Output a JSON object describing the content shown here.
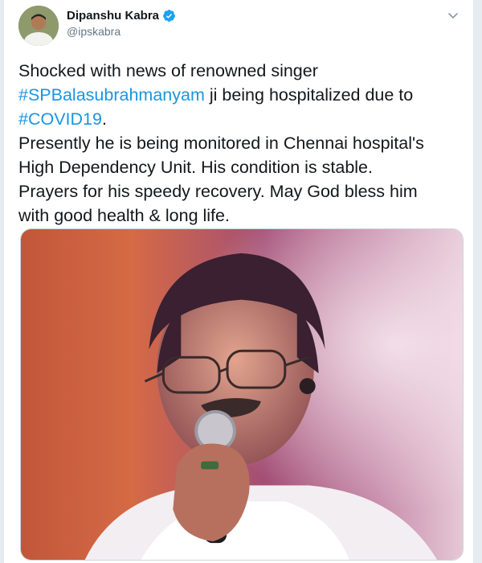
{
  "author": {
    "display_name": "Dipanshu Kabra",
    "handle": "@ipskabra",
    "verified": true
  },
  "icons": {
    "verified": "verified-badge-icon",
    "more": "chevron-down-icon"
  },
  "tweet": {
    "line1": "Shocked with news of renowned singer",
    "hashtag1": "#SPBalasubrahmanyam",
    "line2_rest": " ji being hospitalized due to",
    "hashtag2": "#COVID19",
    "line3_rest": ".",
    "line4": "Presently he is being monitored in Chennai hospital's",
    "line5": "High Dependency Unit. His condition is stable.",
    "line6": "Prayers for his speedy recovery. May God bless him",
    "line7": "with good health & long life."
  },
  "colors": {
    "link": "#1b95e0",
    "text": "#14171a",
    "secondary": "#657786"
  }
}
